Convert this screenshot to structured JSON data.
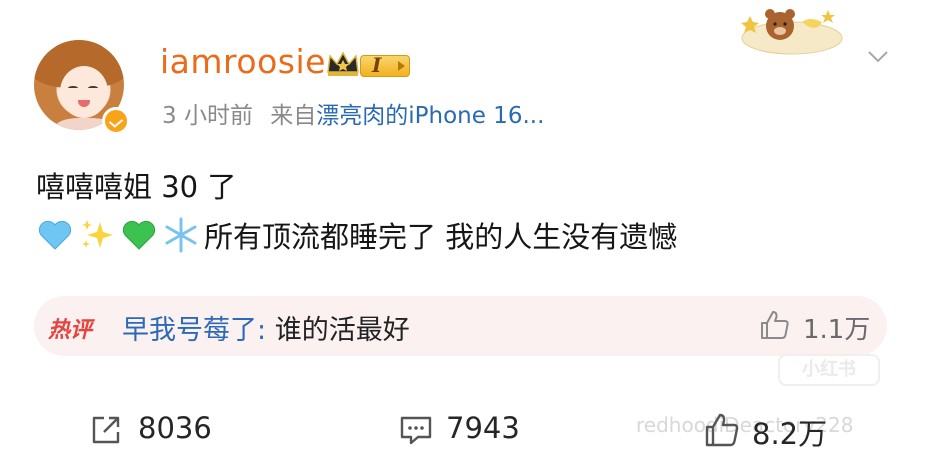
{
  "header": {
    "username": "iamroosie",
    "level_badge": "I",
    "timestamp": "3 小时前",
    "source_prefix": "来自",
    "source_device": "漂亮肉的iPhone 16..."
  },
  "post": {
    "line1": "嘻嘻嘻姐 30 了",
    "line2_emojis": [
      "light-blue-heart",
      "sparkles",
      "green-heart",
      "snowflake"
    ],
    "line2_text": "所有顶流都睡完了 我的人生没有遗憾"
  },
  "hot_comment": {
    "tag": "热评",
    "user": "早我号莓了:",
    "text": " 谁的活最好",
    "likes": "1.1万"
  },
  "actions": {
    "repost_count": "8036",
    "comment_count": "7943",
    "like_count": "8.2万"
  },
  "watermarks": {
    "badge": "小红书",
    "handle": "redhoodiDeactory228"
  },
  "colors": {
    "username": "#ea6c1a",
    "link": "#2a6ab3",
    "hot_tag": "#e5453f",
    "hot_bg": "#fbf1f1",
    "verified": "#f8a31a"
  }
}
